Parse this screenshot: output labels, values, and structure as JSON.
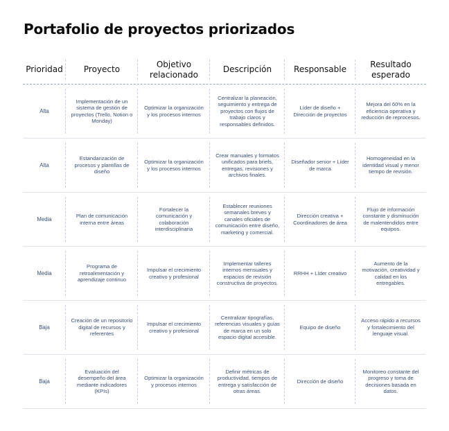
{
  "title": "Portafolio de proyectos priorizados",
  "headers": [
    "Prioridad",
    "Proyecto",
    "Objetivo relacionado",
    "Descripción",
    "Responsable",
    "Resultado esperado"
  ],
  "rows": [
    [
      "Alta",
      "Implementación de un sistema de gestión de proyectos (Trello, Notion o Monday)",
      "Optimizar la organización y los procesos internos",
      "Centralizar la planeación, seguimiento y entrega de proyectos con flujos de trabajo claros y responsables definidos.",
      "Líder de diseño + Dirección de proyectos",
      "Mejora del 60% en la eficiencia operativa y reducción de reprocesos."
    ],
    [
      "Alta",
      "Estandarización de procesos y plantillas de diseño",
      "Optimizar la organización y los procesos internos",
      "Crear manuales y formatos unificados para briefs, entregas, revisiones y archivos finales.",
      "Diseñador senior + Líder de marca",
      "Homogeneidad en la identidad visual y menor tiempo de revisión."
    ],
    [
      "Media",
      "Plan de comunicación interna entre áreas",
      "Fortalecer la comunicación y colaboración interdisciplinaria",
      "Establecer reuniones semanales breves y canales oficiales de comunicación entre diseño, marketing y comercial.",
      "Dirección creativa + Coordinadores de área",
      "Flujo de información constante y disminución de malentendidos entre equipos."
    ],
    [
      "Media",
      "Programa de retroalimentación y aprendizaje continuo",
      "Impulsar el crecimiento creativo y profesional",
      "Implementar talleres internos mensuales y espacios de revisión constructiva de proyectos.",
      "RRHH + Líder creativo",
      "Aumento de la motivación, creatividad y calidad en los entregables."
    ],
    [
      "Baja",
      "Creación de un repositorio digital de recursos y referentes",
      "Impulsar el crecimiento creativo y profesional",
      "Centralizar tipografías, referencias visuales y guías de marca en un solo espacio digital accesible.",
      "Equipo de diseño",
      "Acceso rápido a recursos y fortalecimiento del lenguaje visual."
    ],
    [
      "Baja",
      "Evaluación del desempeño del área mediante indicadores (KPIs)",
      "Optimizar la organización y procesos internos",
      "Definir métricas de productividad, tiempos de entrega y satisfacción de otras áreas.",
      "Dirección de diseño",
      "Monitoreo constante del progreso y toma de decisiones basada en datos."
    ]
  ]
}
